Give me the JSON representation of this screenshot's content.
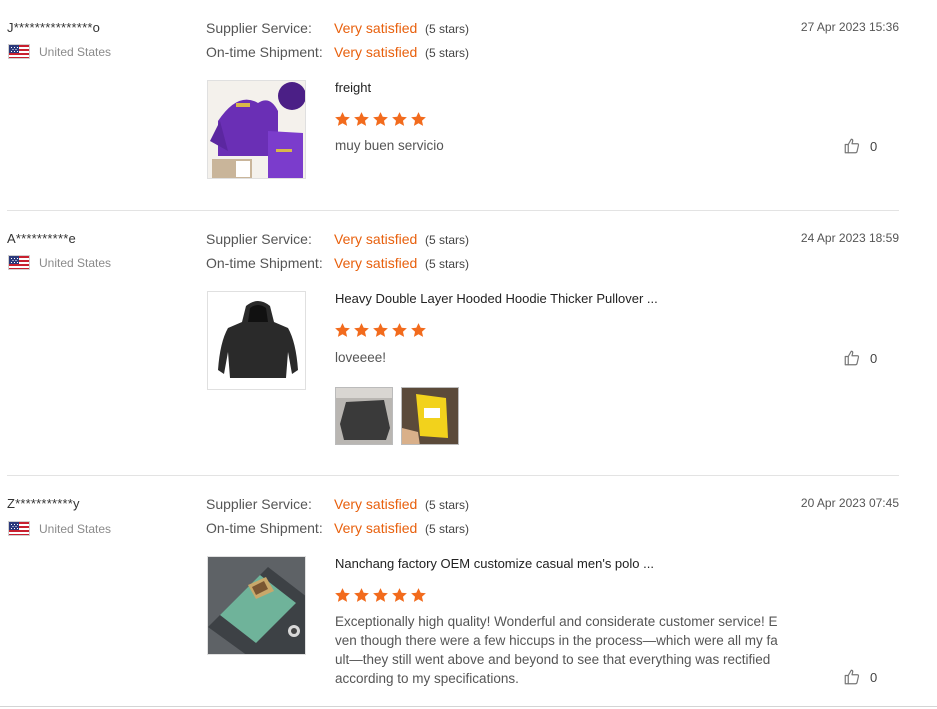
{
  "reviews": [
    {
      "username": "J***************o",
      "country": "United States",
      "flag_icon": "us-flag-icon",
      "supplier_label": "Supplier Service:",
      "supplier_value": "Very satisfied",
      "supplier_stars": "(5 stars)",
      "shipment_label": "On-time Shipment:",
      "shipment_value": "Very satisfied",
      "shipment_stars": "(5 stars)",
      "date": "27 Apr 2023 15:36",
      "product_title": "freight",
      "rating": 5,
      "comment": "muy buen servicio",
      "likes": "0"
    },
    {
      "username": "A**********e",
      "country": "United States",
      "flag_icon": "us-flag-icon",
      "supplier_label": "Supplier Service:",
      "supplier_value": "Very satisfied",
      "supplier_stars": "(5 stars)",
      "shipment_label": "On-time Shipment:",
      "shipment_value": "Very satisfied",
      "shipment_stars": "(5 stars)",
      "date": "24 Apr 2023 18:59",
      "product_title": "Heavy Double Layer Hooded Hoodie Thicker Pullover ...",
      "rating": 5,
      "comment": "loveeee!",
      "likes": "0"
    },
    {
      "username": "Z***********y",
      "country": "United States",
      "flag_icon": "us-flag-icon",
      "supplier_label": "Supplier Service:",
      "supplier_value": "Very satisfied",
      "supplier_stars": "(5 stars)",
      "shipment_label": "On-time Shipment:",
      "shipment_value": "Very satisfied",
      "shipment_stars": "(5 stars)",
      "date": "20 Apr 2023 07:45",
      "product_title": "Nanchang factory OEM customize casual men's polo ...",
      "rating": 5,
      "comment_lines": [
        "Exceptionally high quality! Wonderful and considerate customer service! E",
        "ven though there were a few hiccups in the process—which were all my fa",
        "ult—they still went above and beyond to see that everything was rectified",
        "according to my specifications."
      ],
      "likes": "0"
    }
  ],
  "colors": {
    "accent": "#e8600d",
    "star": "#f26b1d",
    "divider": "#e3e3e3"
  },
  "icons": {
    "like": "thumbs-up-icon",
    "star": "star-icon"
  }
}
